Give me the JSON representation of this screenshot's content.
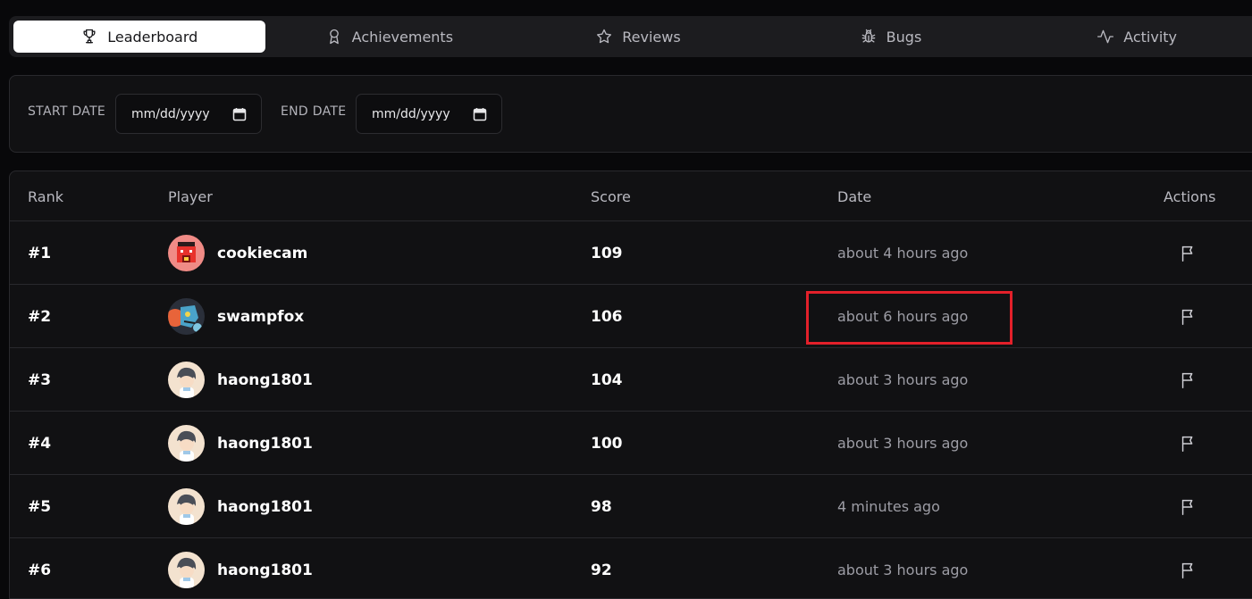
{
  "tabs": [
    {
      "label": "Leaderboard",
      "icon": "trophy-icon",
      "active": true
    },
    {
      "label": "Achievements",
      "icon": "award-icon",
      "active": false
    },
    {
      "label": "Reviews",
      "icon": "star-icon",
      "active": false
    },
    {
      "label": "Bugs",
      "icon": "bug-icon",
      "active": false
    },
    {
      "label": "Activity",
      "icon": "activity-icon",
      "active": false
    }
  ],
  "filters": {
    "start_label": "START DATE",
    "start_value": "mm/dd/yyyy",
    "end_label": "END DATE",
    "end_value": "mm/dd/yyyy"
  },
  "table": {
    "headers": {
      "rank": "Rank",
      "player": "Player",
      "score": "Score",
      "date": "Date",
      "actions": "Actions"
    },
    "rows": [
      {
        "rank": "#1",
        "player": "cookiecam",
        "score": "109",
        "date": "about 4 hours ago",
        "avatar": "cookie-avatar"
      },
      {
        "rank": "#2",
        "player": "swampfox",
        "score": "106",
        "date": "about 6 hours ago",
        "avatar": "swamp-avatar"
      },
      {
        "rank": "#3",
        "player": "haong1801",
        "score": "104",
        "date": "about 3 hours ago",
        "avatar": "haong-avatar"
      },
      {
        "rank": "#4",
        "player": "haong1801",
        "score": "100",
        "date": "about 3 hours ago",
        "avatar": "haong-avatar"
      },
      {
        "rank": "#5",
        "player": "haong1801",
        "score": "98",
        "date": "4 minutes ago",
        "avatar": "haong-avatar"
      },
      {
        "rank": "#6",
        "player": "haong1801",
        "score": "92",
        "date": "about 3 hours ago",
        "avatar": "haong-avatar"
      }
    ]
  },
  "colors": {
    "background": "#08080a",
    "panel": "#111113",
    "active_tab": "#ffffff",
    "highlight_box": "#e3202a"
  }
}
